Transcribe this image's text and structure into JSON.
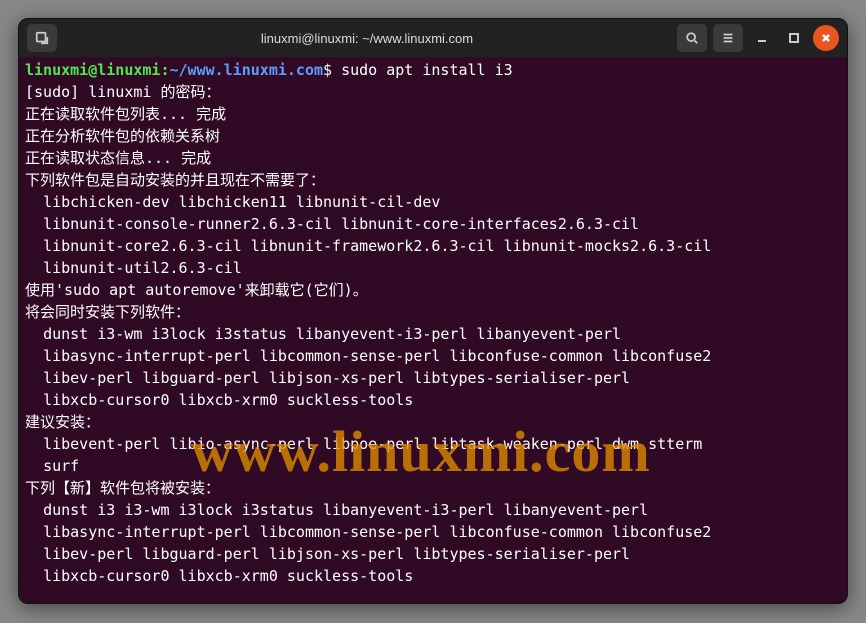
{
  "window": {
    "title": "linuxmi@linuxmi: ~/www.linuxmi.com"
  },
  "prompt": {
    "user_host": "linuxmi@linuxmi",
    "colon": ":",
    "path": "~/www.linuxmi.com",
    "dollar": "$",
    "command": " sudo apt install i3"
  },
  "lines": {
    "l1": "[sudo] linuxmi 的密码：",
    "l2": "正在读取软件包列表... 完成",
    "l3": "正在分析软件包的依赖关系树",
    "l4": "正在读取状态信息... 完成",
    "l5": "下列软件包是自动安装的并且现在不需要了：",
    "l6": "  libchicken-dev libchicken11 libnunit-cil-dev",
    "l7": "  libnunit-console-runner2.6.3-cil libnunit-core-interfaces2.6.3-cil",
    "l8": "  libnunit-core2.6.3-cil libnunit-framework2.6.3-cil libnunit-mocks2.6.3-cil",
    "l9": "  libnunit-util2.6.3-cil",
    "l10": "使用'sudo apt autoremove'来卸载它(它们)。",
    "l11": "将会同时安装下列软件：",
    "l12": "  dunst i3-wm i3lock i3status libanyevent-i3-perl libanyevent-perl",
    "l13": "  libasync-interrupt-perl libcommon-sense-perl libconfuse-common libconfuse2",
    "l14": "  libev-perl libguard-perl libjson-xs-perl libtypes-serialiser-perl",
    "l15": "  libxcb-cursor0 libxcb-xrm0 suckless-tools",
    "l16": "建议安装：",
    "l17": "  libevent-perl libio-async-perl libpoe-perl libtask-weaken-perl dwm stterm",
    "l18": "  surf",
    "l19": "下列【新】软件包将被安装：",
    "l20": "  dunst i3 i3-wm i3lock i3status libanyevent-i3-perl libanyevent-perl",
    "l21": "  libasync-interrupt-perl libcommon-sense-perl libconfuse-common libconfuse2",
    "l22": "  libev-perl libguard-perl libjson-xs-perl libtypes-serialiser-perl",
    "l23": "  libxcb-cursor0 libxcb-xrm0 suckless-tools"
  },
  "watermark": "www.linuxmi.com"
}
